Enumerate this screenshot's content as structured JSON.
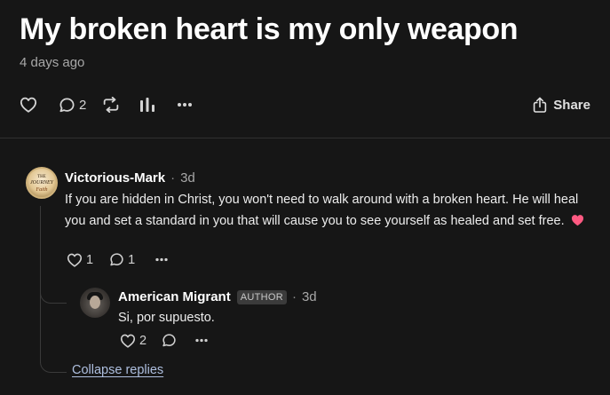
{
  "post": {
    "title": "My broken heart is my only weapon",
    "date": "4 days ago"
  },
  "actions": {
    "comment_count": "2",
    "share_label": "Share"
  },
  "comments": [
    {
      "author": "Victorious-Mark",
      "time": "3d",
      "avatar_text": [
        "THE",
        "JOURNEY",
        "Faith"
      ],
      "body": "If you are hidden in Christ, you won't need to walk around with a broken heart. He will heal you and set a standard in you that will cause you to see yourself as healed and set free.",
      "emoji": "❤",
      "likes": "1",
      "replies": "1"
    },
    {
      "author": "American Migrant",
      "badge": "AUTHOR",
      "time": "3d",
      "body": "Si, por supuesto.",
      "likes": "2"
    }
  ],
  "collapse_label": "Collapse replies",
  "colors": {
    "background": "#161616",
    "link": "#aebfdf",
    "heart": "#ff5a82"
  }
}
